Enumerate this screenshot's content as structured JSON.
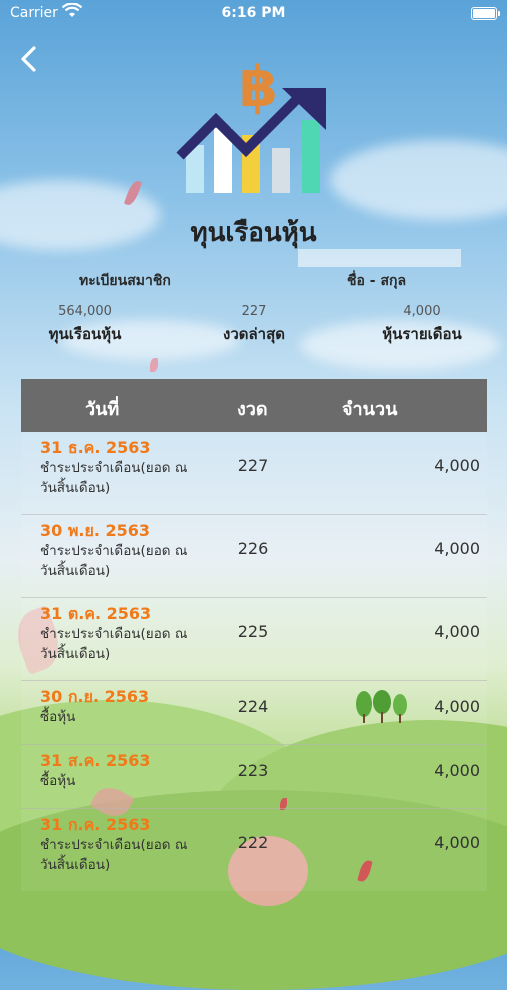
{
  "status_bar": {
    "carrier": "Carrier",
    "time": "6:16 PM"
  },
  "header": {
    "title": "ทุนเรือนหุ้น"
  },
  "member": {
    "id_label": "ทะเบียนสมาชิก",
    "name_label": "ชื่อ - สกุล"
  },
  "summary": [
    {
      "value": "564,000",
      "label": "ทุนเรือนหุ้น"
    },
    {
      "value": "227",
      "label": "งวดล่าสุด"
    },
    {
      "value": "4,000",
      "label": "หุ้นรายเดือน"
    }
  ],
  "table": {
    "headers": [
      "วันที่",
      "งวด",
      "จำนวน"
    ],
    "rows": [
      {
        "date": "31 ธ.ค. 2563",
        "desc": "ชำระประจำเดือน(ยอด ณ วันสิ้นเดือน)",
        "period": "227",
        "amount": "4,000"
      },
      {
        "date": "30 พ.ย. 2563",
        "desc": "ชำระประจำเดือน(ยอด ณ วันสิ้นเดือน)",
        "period": "226",
        "amount": "4,000"
      },
      {
        "date": "31 ต.ค. 2563",
        "desc": "ชำระประจำเดือน(ยอด ณ วันสิ้นเดือน)",
        "period": "225",
        "amount": "4,000"
      },
      {
        "date": "30 ก.ย. 2563",
        "desc": "ซื้อหุ้น",
        "period": "224",
        "amount": "4,000"
      },
      {
        "date": "31 ส.ค. 2563",
        "desc": "ซื้อหุ้น",
        "period": "223",
        "amount": "4,000"
      },
      {
        "date": "31 ก.ค. 2563",
        "desc": "ชำระประจำเดือน(ยอด ณ วันสิ้นเดือน)",
        "period": "222",
        "amount": "4,000"
      }
    ]
  },
  "colors": {
    "header_bg": "#6b6b6b",
    "date_text": "#f07a1a",
    "logo_arrow": "#2e2a6e",
    "logo_coin": "#e08a3a"
  },
  "icons": {
    "back": "chevron-left-icon",
    "wifi": "wifi-icon",
    "battery": "battery-icon",
    "logo": "bitcoin-growth-chart-icon"
  }
}
